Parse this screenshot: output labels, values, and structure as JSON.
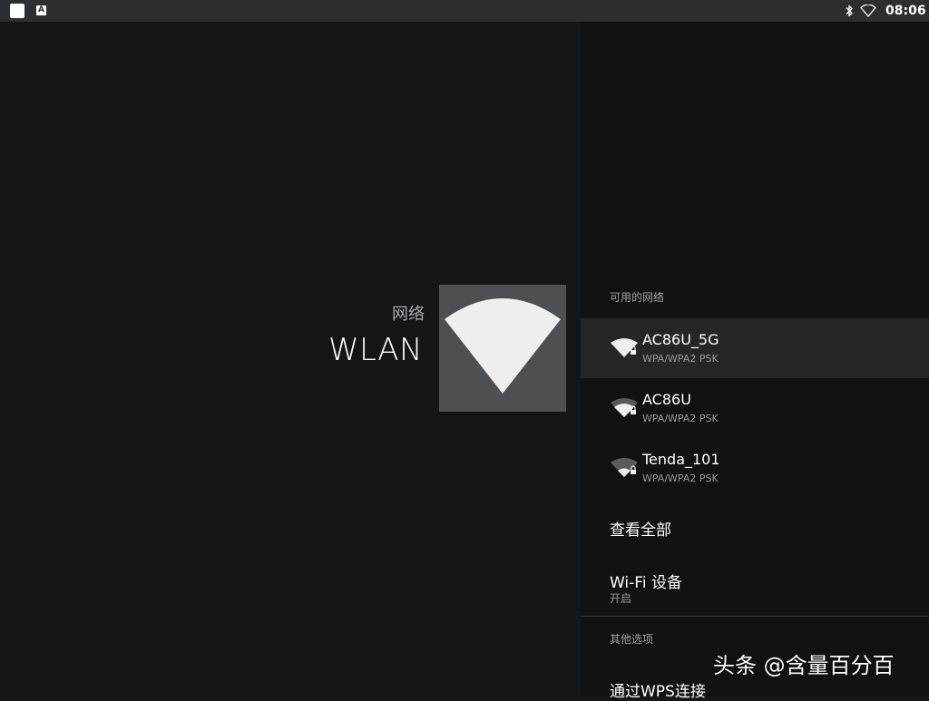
{
  "status_bar": {
    "time": "08:06",
    "a_badge": "A",
    "icons": [
      "square-notification-icon",
      "a-notification-icon",
      "bluetooth-icon",
      "wifi-icon"
    ]
  },
  "left": {
    "category": "网络",
    "title": "WLAN",
    "hero_icon": "wifi-large-icon"
  },
  "right": {
    "available_header": "可用的网络",
    "networks": [
      {
        "name": "AC86U_5G",
        "security": "WPA/WPA2 PSK",
        "signal_bars": 4,
        "selected": true
      },
      {
        "name": "AC86U",
        "security": "WPA/WPA2 PSK",
        "signal_bars": 3,
        "selected": false
      },
      {
        "name": "Tenda_101",
        "security": "WPA/WPA2 PSK",
        "signal_bars": 2,
        "selected": false
      }
    ],
    "see_all": "查看全部",
    "wifi_device": "Wi-Fi 设备",
    "wifi_device_state": "开启",
    "other_header": "其他选项",
    "wps": "通过WPS连接"
  },
  "watermark": "头条 @含量百分百",
  "colors": {
    "background": "#13171a",
    "panel": "#121212",
    "selected_row": "#262626",
    "hero_tile": "#4c5052",
    "icon_fill": "#eeeeee",
    "icon_dim": "#5a5a5a"
  }
}
